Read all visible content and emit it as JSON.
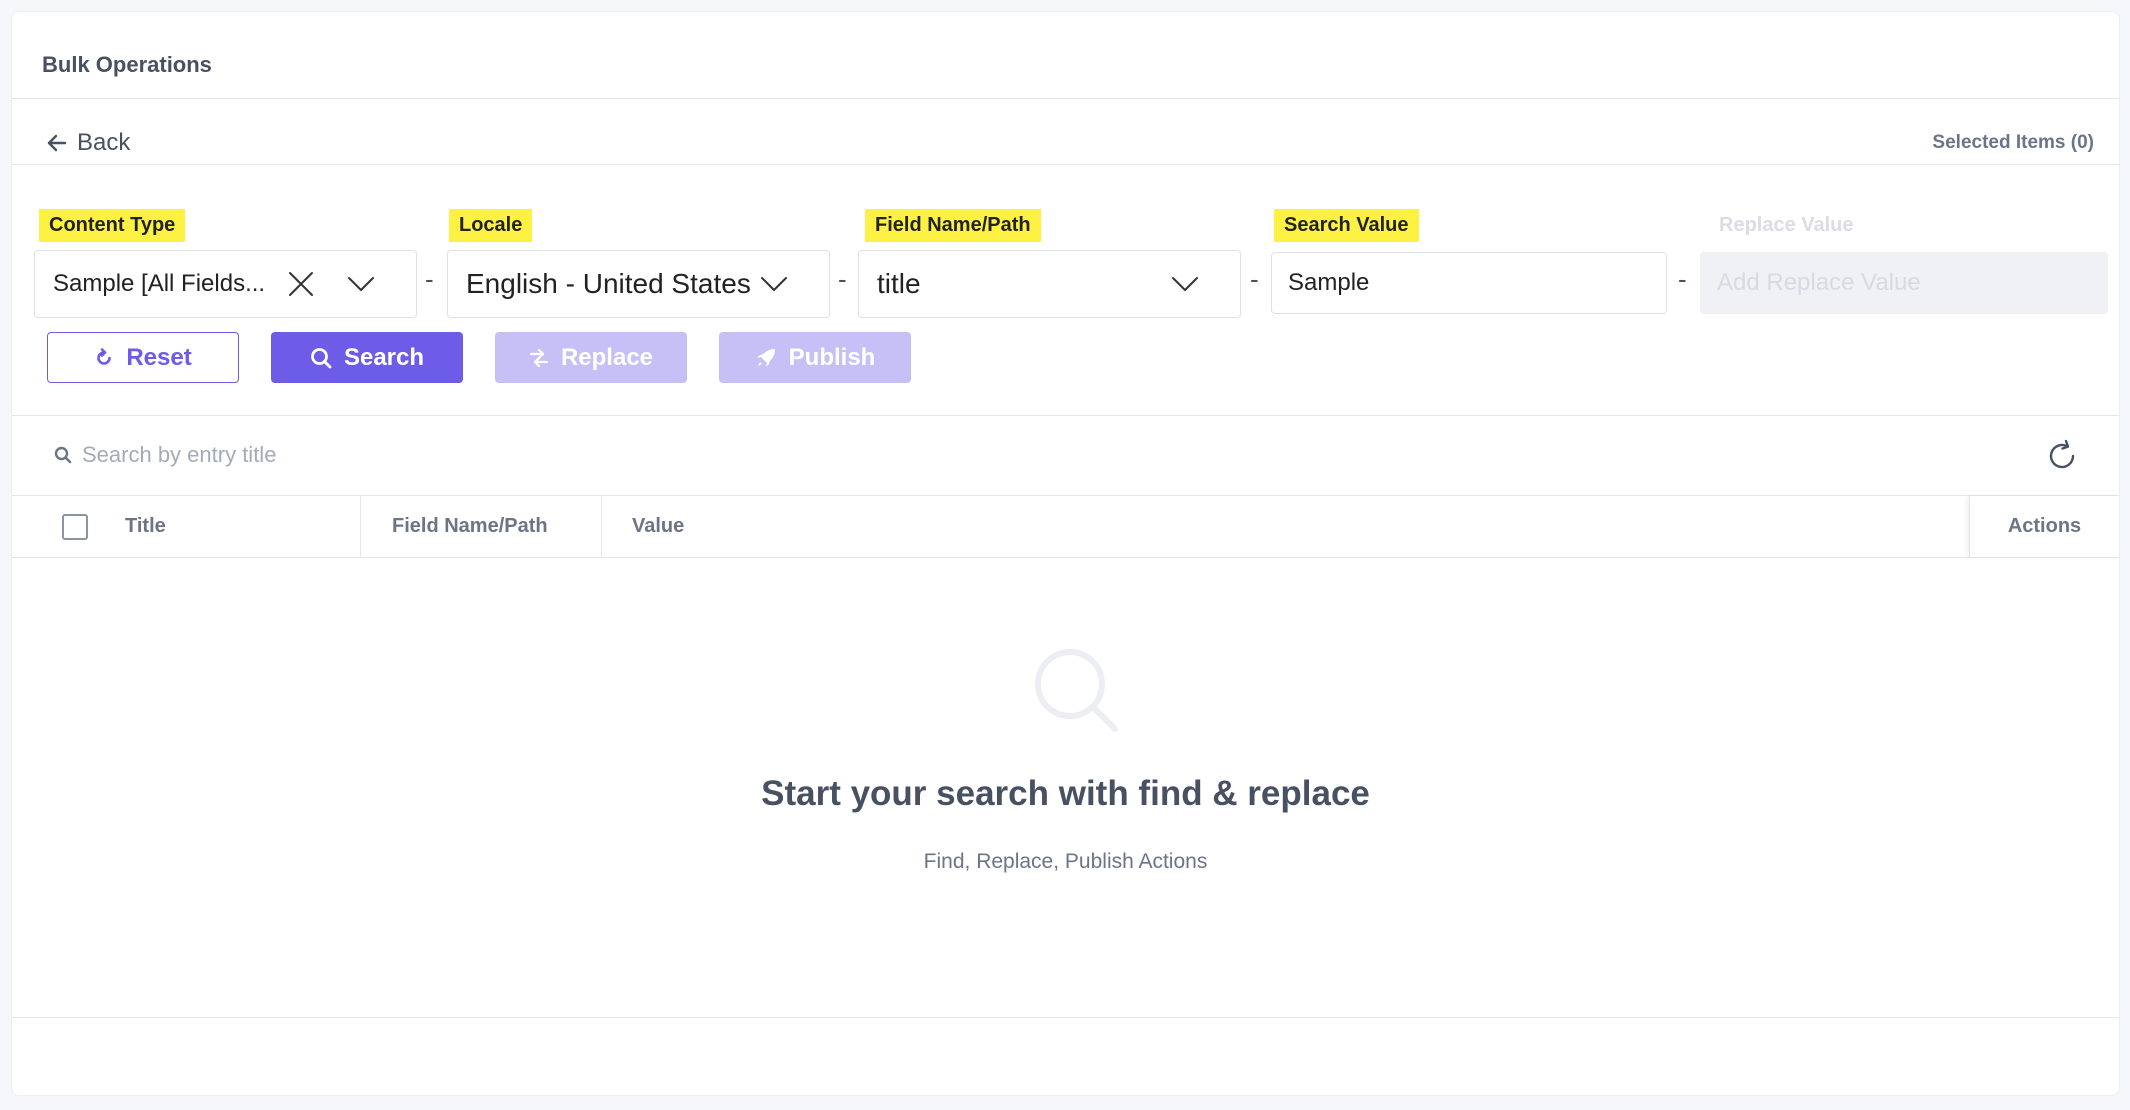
{
  "header": {
    "title": "Bulk Operations"
  },
  "toolbar": {
    "back_label": "Back",
    "selected_items": "Selected Items (0)"
  },
  "filters": {
    "content_type": {
      "label": "Content Type",
      "value": "Sample [All Fields..."
    },
    "locale": {
      "label": "Locale",
      "value": "English - United States"
    },
    "field_name": {
      "label": "Field Name/Path",
      "value": "title"
    },
    "search_value": {
      "label": "Search Value",
      "value": "Sample"
    },
    "replace_value": {
      "label": "Replace Value",
      "placeholder": "Add Replace Value"
    },
    "separator": "-"
  },
  "actions": {
    "reset": "Reset",
    "search": "Search",
    "replace": "Replace",
    "publish": "Publish"
  },
  "results": {
    "search_placeholder": "Search by entry title",
    "columns": [
      "Title",
      "Field Name/Path",
      "Value",
      "Actions"
    ]
  },
  "empty_state": {
    "title": "Start your search with find & replace",
    "subtitle": "Find, Replace, Publish Actions"
  },
  "colors": {
    "primary": "#6c5ce7",
    "primary_disabled": "#c6c0f6",
    "highlight": "#fdf244"
  }
}
